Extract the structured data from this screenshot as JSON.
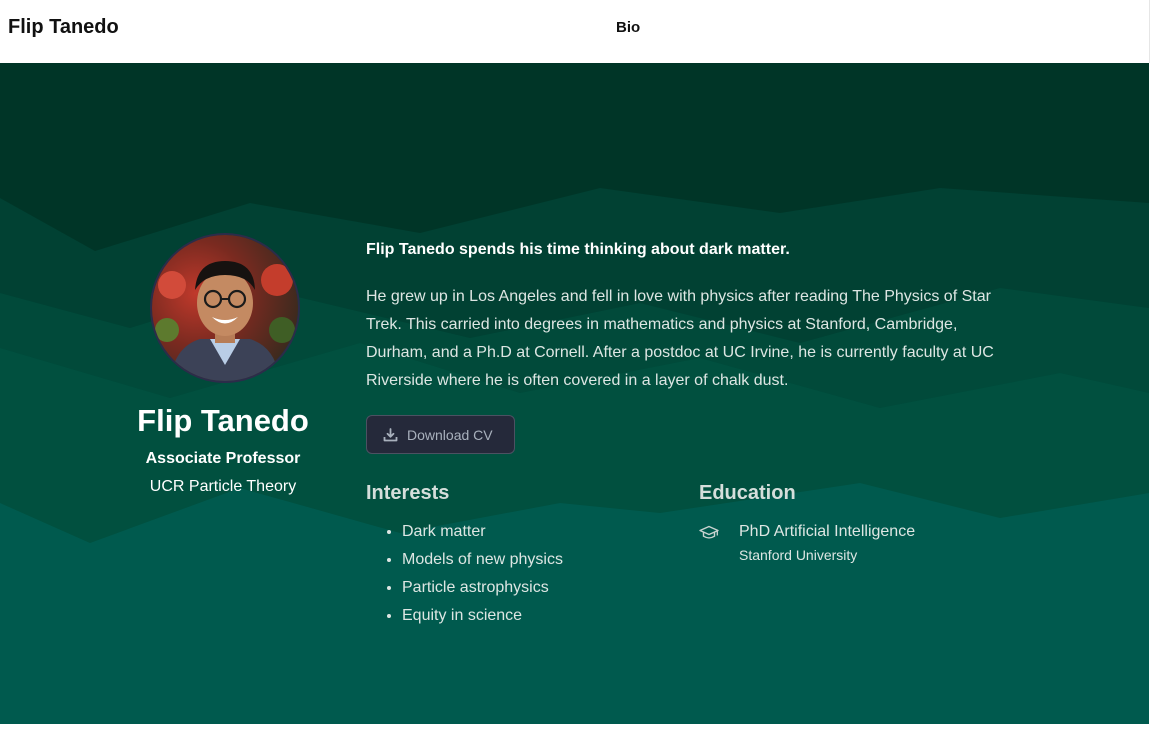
{
  "header": {
    "brand": "Flip Tanedo",
    "nav": [
      {
        "label": "Bio"
      }
    ]
  },
  "profile": {
    "name": "Flip Tanedo",
    "role": "Associate Professor",
    "organization": "UCR Particle Theory"
  },
  "bio": {
    "lead": "Flip Tanedo spends his time thinking about dark matter.",
    "body": "He grew up in Los Angeles and fell in love with physics after reading The Physics of Star Trek. This carried into degrees in mathematics and physics at Stanford, Cambridge, Durham, and a Ph.D at Cornell. After a postdoc at UC Irvine, he is currently faculty at UC Riverside where he is often covered in a layer of chalk dust.",
    "cv_button_label": "Download CV"
  },
  "interests": {
    "title": "Interests",
    "items": [
      "Dark matter",
      "Models of new physics",
      "Particle astrophysics",
      "Equity in science"
    ]
  },
  "education": {
    "title": "Education",
    "items": [
      {
        "degree": "PhD Artificial Intelligence",
        "institution": "Stanford University",
        "icon": "graduation-cap-icon"
      }
    ]
  },
  "colors": {
    "hero_dark": "#003527",
    "hero_mid": "#014536",
    "hero_teal": "#005a4e",
    "button_bg": "#25293a"
  }
}
